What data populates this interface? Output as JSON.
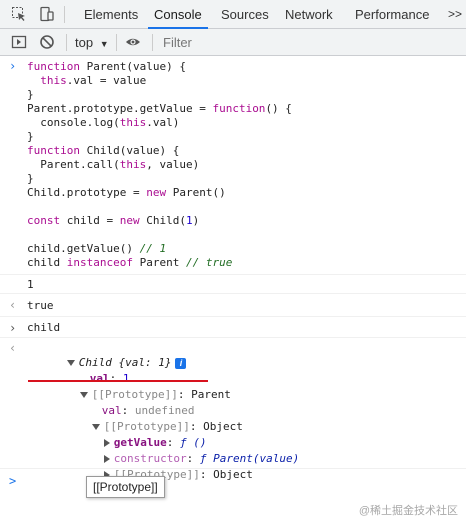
{
  "devtools": {
    "tabs": [
      "Elements",
      "Console",
      "Sources",
      "Network",
      "Performance"
    ],
    "active_tab": "Console",
    "more_tabs_label": ">>"
  },
  "toolbar": {
    "context": "top",
    "context_caret": "▼",
    "filter_placeholder": "Filter"
  },
  "console": {
    "input_code": [
      "function Parent(value) {",
      "  this.val = value",
      "}",
      "Parent.prototype.getValue = function() {",
      "  console.log(this.val)",
      "}",
      "function Child(value) {",
      "  Parent.call(this, value)",
      "}",
      "Child.prototype = new Parent()",
      "",
      "const child = new Child(1)",
      "",
      "child.getValue() // 1",
      "child instanceof Parent // true"
    ],
    "log_output": "1",
    "result_true": "true",
    "input2": "child",
    "object_tree": {
      "summary_name": "Child",
      "summary_body": "{val: 1}",
      "info_icon": "i",
      "val_key": "val",
      "val_value": "1",
      "proto1_key": "[[Prototype]]",
      "proto1_value": "Parent",
      "proto1_val_key": "val",
      "proto1_val_value": "undefined",
      "proto2_key": "[[Prototype]]",
      "proto2_value": "Object",
      "getvalue_key": "getValue",
      "getvalue_value": "ƒ ()",
      "constructor_key": "constructor",
      "constructor_value": "ƒ Parent(value)",
      "proto3_key": "[[Prototype]]",
      "proto3_value": "Object"
    },
    "prompt": ">"
  },
  "tooltip": "[[Prototype]]",
  "watermark": "@稀土掘金技术社区",
  "colors": {
    "accent": "#1a73e8",
    "annotation_red": "#d8121e",
    "keyword": "#aa0d91",
    "comment": "#236e25"
  }
}
